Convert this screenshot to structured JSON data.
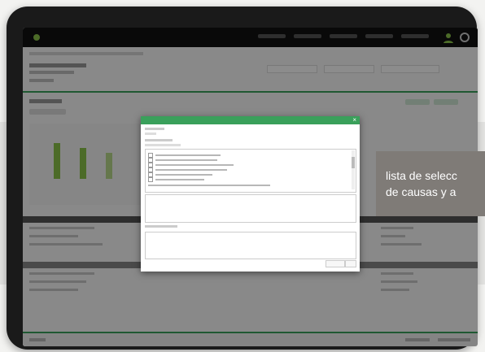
{
  "callout": {
    "text": "lista de selecc\nde causas y a"
  },
  "colors": {
    "accent": "#3aa05b",
    "chart": "#8bc34a",
    "topbar": "#111111",
    "callout_bg": "#7f7b77"
  },
  "icons": [
    "close-icon",
    "checkbox-icon",
    "scrollbar"
  ]
}
